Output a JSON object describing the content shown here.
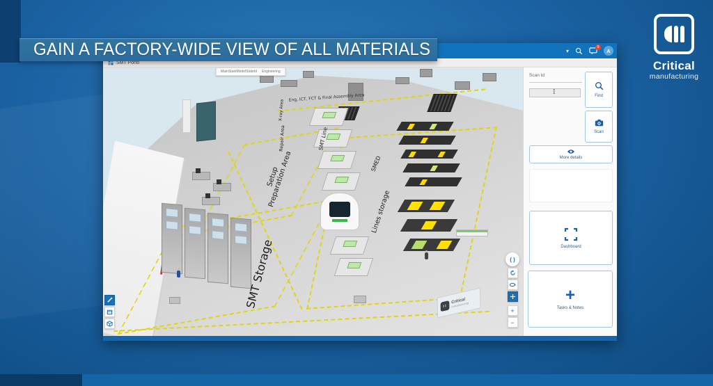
{
  "banner": {
    "title": "GAIN A FACTORY-WIDE VIEW OF ALL MATERIALS"
  },
  "brand": {
    "name": "Critical",
    "tagline": "manufacturing"
  },
  "window": {
    "title": "SMT Porto",
    "topbar": {
      "avatar_initial": "A",
      "notification_count": "9"
    },
    "tooltip": {
      "key": "MainStateModelStateId",
      "value": "Engineering"
    }
  },
  "sidebar": {
    "scan_id_label": "Scan Id",
    "find_label": "Find",
    "scan_label": "Scan",
    "more_details_label": "More details",
    "dashboard_label": "Dashboard",
    "tasks_notes_label": "Tasks & Notes"
  },
  "viewer": {
    "focus_glyph": "( )",
    "zoom_in": "+",
    "zoom_out": "−"
  },
  "factory": {
    "zones": [
      {
        "label": "SMT Storage"
      },
      {
        "label": "Setup Preparation Area"
      },
      {
        "label": "Lines storage"
      },
      {
        "label": "SMED"
      },
      {
        "label": "SMT Line"
      },
      {
        "label": "Repair Area"
      },
      {
        "label": "X-ray Area"
      },
      {
        "label": "Eng, ICT, FCT & Final Assembly Area"
      }
    ],
    "watermark": {
      "name": "Critical",
      "tagline": "manufacturing"
    }
  },
  "colors": {
    "accent": "#1b6fb5",
    "banner_bg": "#2f6fa5",
    "floor_marking": "#e3d40a",
    "badge": "#e8452f"
  }
}
